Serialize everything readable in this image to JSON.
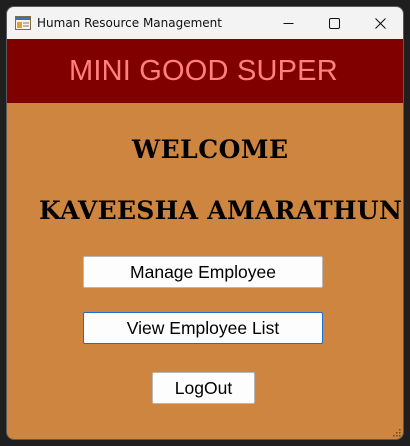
{
  "window": {
    "title": "Human Resource Management",
    "icon": "app-window-icon",
    "controls": [
      "minimize-icon",
      "maximize-icon",
      "close-icon"
    ]
  },
  "banner": {
    "brand": "MINI GOOD SUPER",
    "background": "#800000",
    "text_color": "#ff8080"
  },
  "main": {
    "background": "#cd853f",
    "welcome": "WELCOME",
    "username": "KAVEESHA AMARATHUNGA",
    "buttons": {
      "manage": "Manage Employee",
      "view": "View Employee List",
      "logout": "LogOut"
    }
  }
}
